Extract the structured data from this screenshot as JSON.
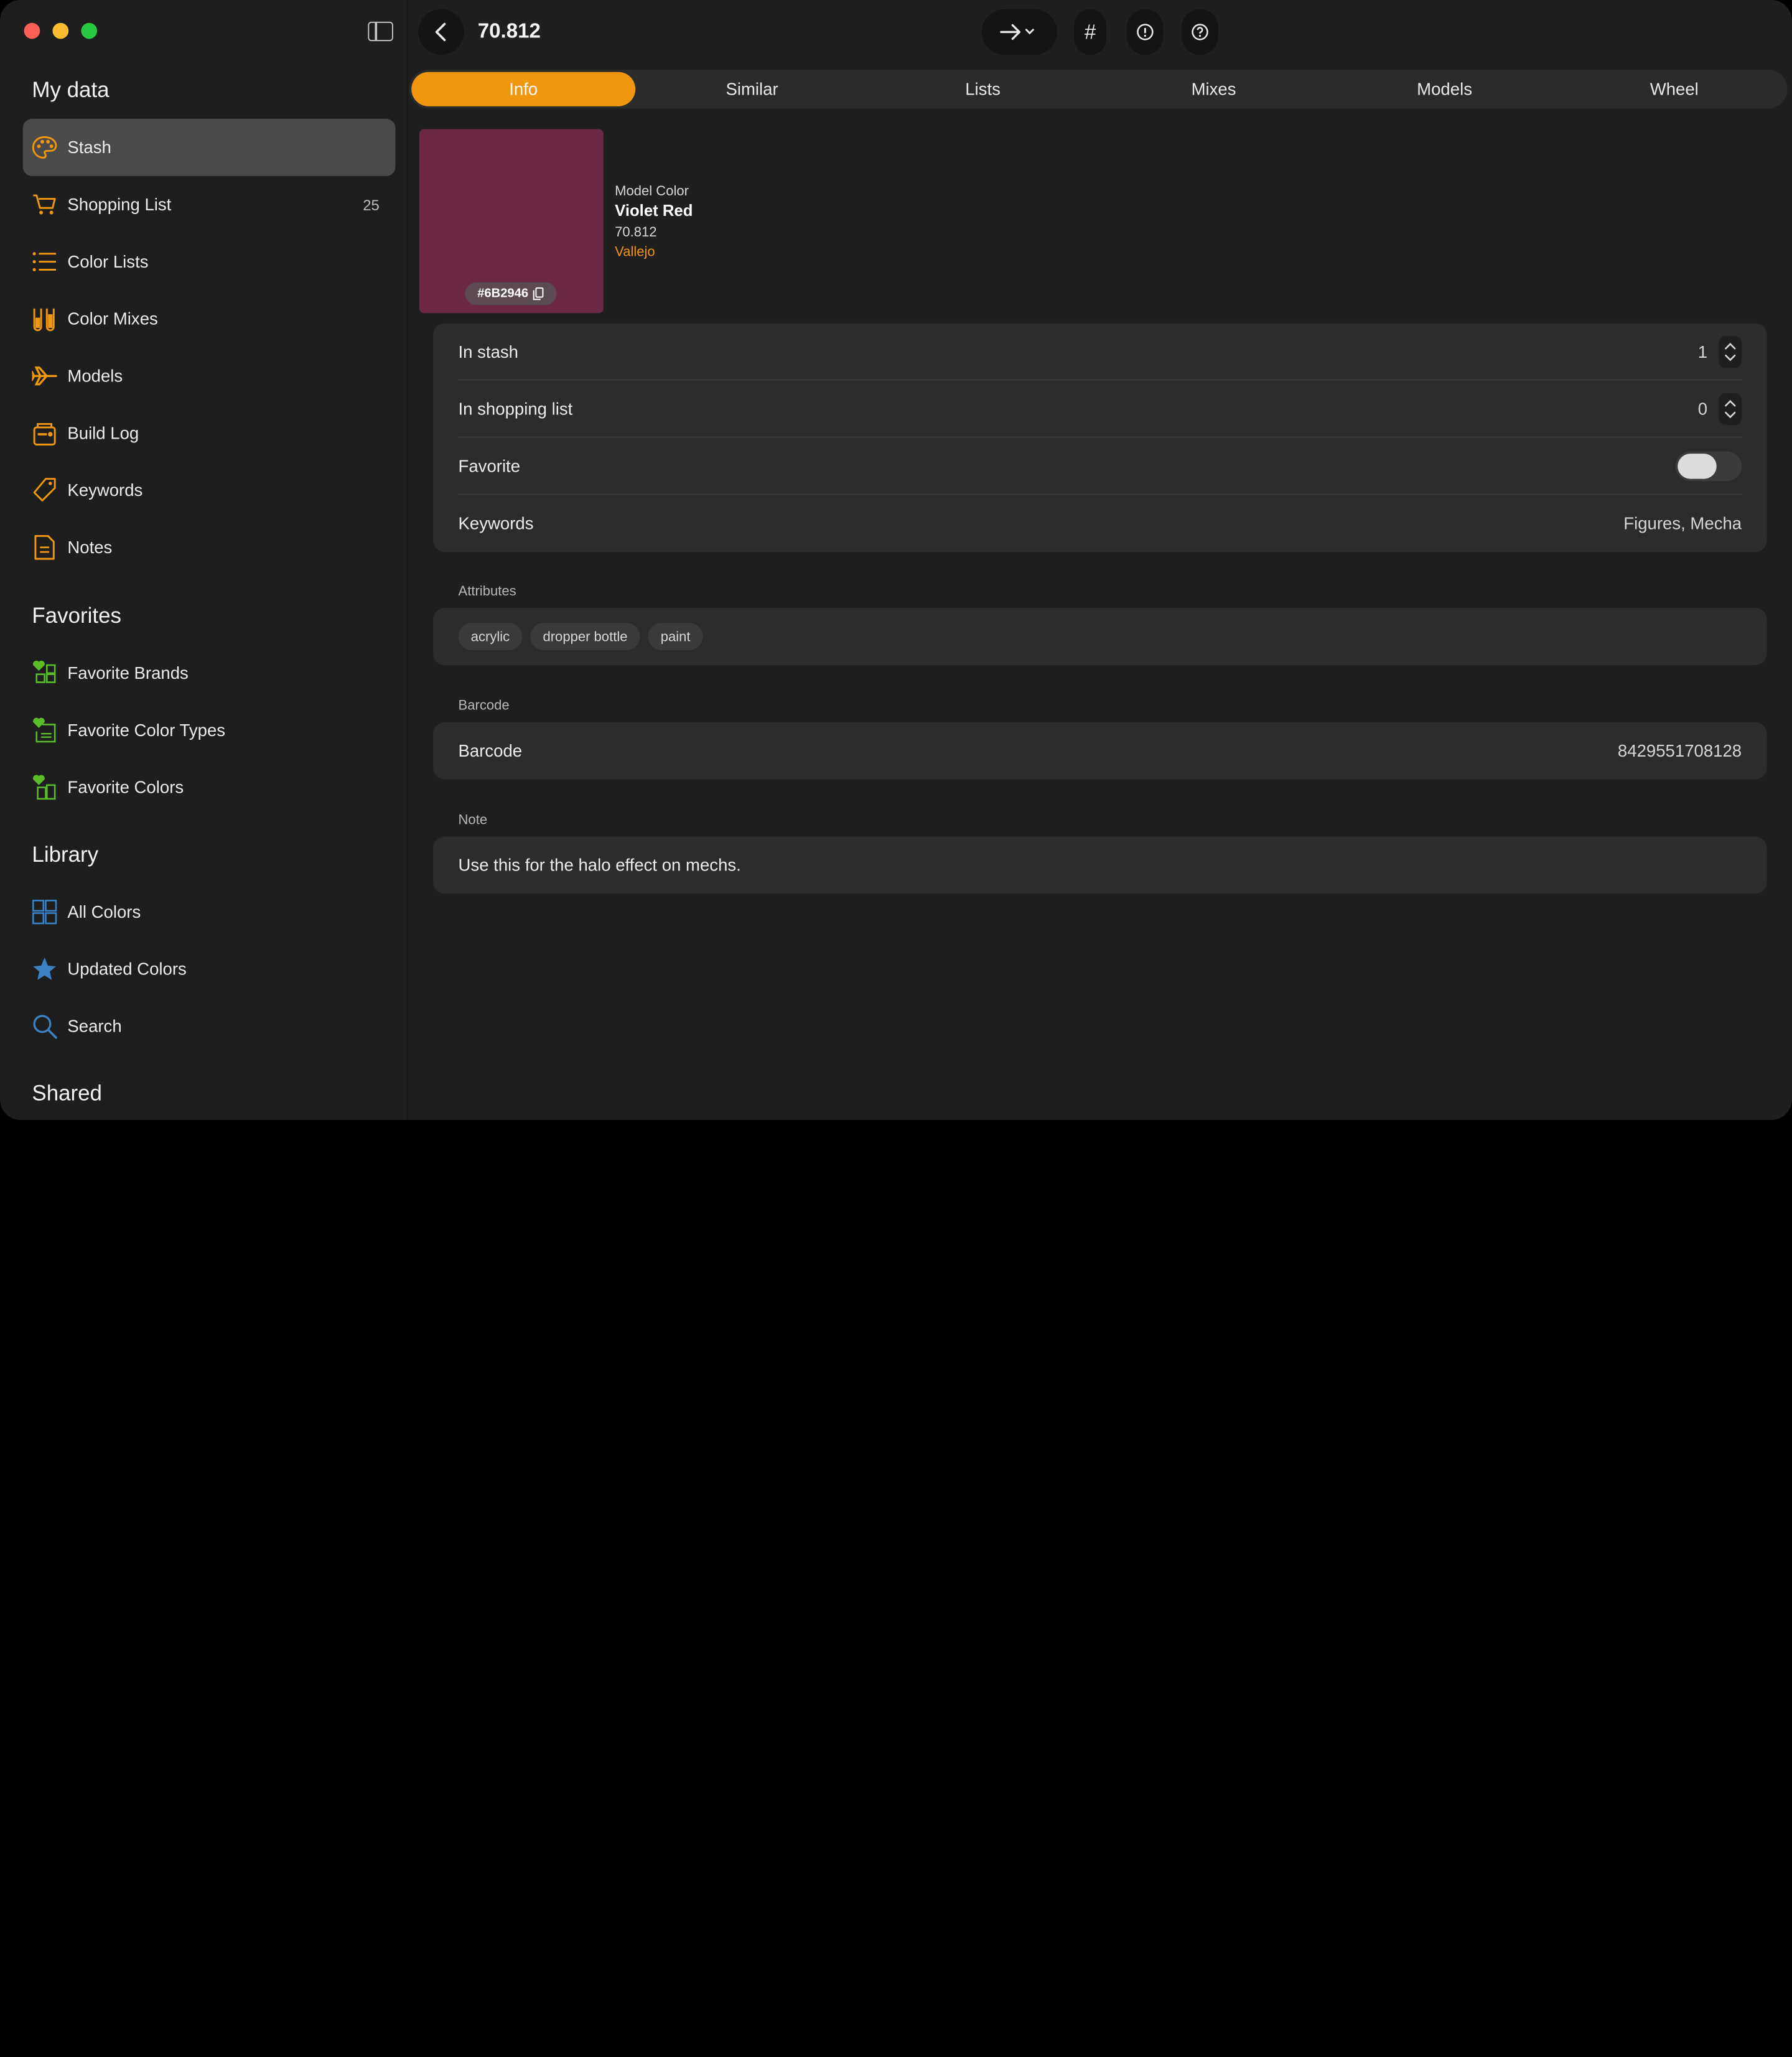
{
  "window": {
    "title": "70.812"
  },
  "sidebar": {
    "my_data_title": "My data",
    "my_data": [
      {
        "label": "Stash",
        "count": "",
        "icon": "palette-icon"
      },
      {
        "label": "Shopping List",
        "count": "25",
        "icon": "cart-icon"
      },
      {
        "label": "Color Lists",
        "count": "",
        "icon": "list-icon"
      },
      {
        "label": "Color Mixes",
        "count": "",
        "icon": "test-tubes-icon"
      },
      {
        "label": "Models",
        "count": "",
        "icon": "airplane-icon"
      },
      {
        "label": "Build Log",
        "count": "",
        "icon": "build-log-icon"
      },
      {
        "label": "Keywords",
        "count": "",
        "icon": "tag-icon"
      },
      {
        "label": "Notes",
        "count": "",
        "icon": "document-icon"
      }
    ],
    "favorites_title": "Favorites",
    "favorites": [
      {
        "label": "Favorite Brands",
        "icon": "favorite-brands-icon"
      },
      {
        "label": "Favorite Color Types",
        "icon": "favorite-types-icon"
      },
      {
        "label": "Favorite Colors",
        "icon": "favorite-colors-icon"
      }
    ],
    "library_title": "Library",
    "library": [
      {
        "label": "All Colors",
        "icon": "grid-icon"
      },
      {
        "label": "Updated Colors",
        "icon": "star-icon"
      },
      {
        "label": "Search",
        "icon": "magnifier-icon"
      }
    ],
    "shared_title": "Shared"
  },
  "toolbar": {
    "hash": "#"
  },
  "tabs": [
    "Info",
    "Similar",
    "Lists",
    "Mixes",
    "Models",
    "Wheel"
  ],
  "color": {
    "hex": "#6B2946",
    "type": "Model Color",
    "name": "Violet Red",
    "code": "70.812",
    "brand": "Vallejo"
  },
  "details": {
    "in_stash_label": "In stash",
    "in_stash": "1",
    "shopping_label": "In shopping list",
    "shopping": "0",
    "favorite_label": "Favorite",
    "favorite_on": false,
    "keywords_label": "Keywords",
    "keywords": "Figures, Mecha"
  },
  "attributes": {
    "title": "Attributes",
    "chips": [
      "acrylic",
      "dropper bottle",
      "paint"
    ]
  },
  "barcode": {
    "title": "Barcode",
    "label": "Barcode",
    "value": "8429551708128"
  },
  "note": {
    "title": "Note",
    "text": "Use this for the halo effect on mechs."
  },
  "colors": {
    "accent": "#f0960f",
    "favorite_green": "#5bbd2b",
    "library_blue": "#3b82c4"
  }
}
